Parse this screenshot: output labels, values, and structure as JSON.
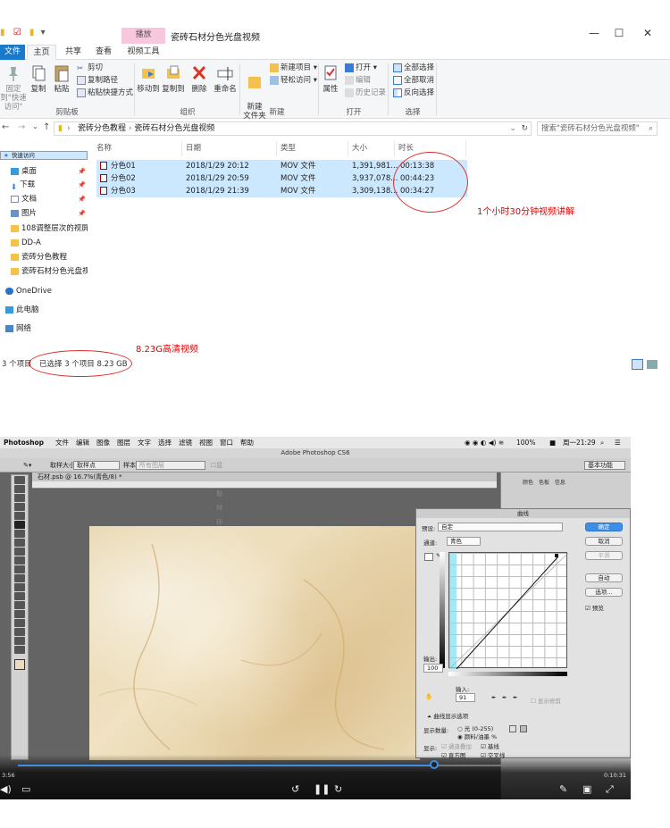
{
  "explorer": {
    "title": "瓷砖石材分色光盘视频",
    "context_tab": "播放",
    "tabs": [
      "文件",
      "主页",
      "共享",
      "查看",
      "视频工具"
    ],
    "ribbon": {
      "clipboard": {
        "pin": "固定到\"快速访问\"",
        "copy": "复制",
        "paste": "粘贴",
        "cut": "剪切",
        "copy_path": "复制路径",
        "paste_shortcut": "粘贴快捷方式",
        "label": "剪贴板"
      },
      "organize": {
        "move_to": "移动到",
        "copy_to": "复制到",
        "delete": "删除",
        "rename": "重命名",
        "label": "组织"
      },
      "new": {
        "new_folder": "新建\n文件夹",
        "new_item": "新建项目",
        "easy_access": "轻松访问",
        "label": "新建"
      },
      "open": {
        "properties": "属性",
        "open": "打开",
        "edit": "编辑",
        "history": "历史记录",
        "label": "打开"
      },
      "select": {
        "select_all": "全部选择",
        "select_none": "全部取消",
        "invert": "反向选择",
        "label": "选择"
      }
    },
    "address": {
      "crumb1": "瓷砖分色教程",
      "crumb2": "瓷砖石材分色光盘视频",
      "search_placeholder": "搜索\"瓷砖石材分色光盘视频\""
    },
    "nav": {
      "quick_access": "快速访问",
      "items": [
        "桌面",
        "下载",
        "文档",
        "图片",
        "108调整层次的视屏",
        "DD-A",
        "瓷砖分色教程",
        "瓷砖石材分色光盘视"
      ],
      "onedrive": "OneDrive",
      "this_pc": "此电脑",
      "network": "网络"
    },
    "columns": [
      "名称",
      "日期",
      "类型",
      "大小",
      "时长"
    ],
    "files": [
      {
        "name": "分色01",
        "date": "2018/1/29 20:12",
        "type": "MOV 文件",
        "size": "1,391,981...",
        "duration": "00:13:38"
      },
      {
        "name": "分色02",
        "date": "2018/1/29 20:59",
        "type": "MOV 文件",
        "size": "3,937,078...",
        "duration": "00:44:23"
      },
      {
        "name": "分色03",
        "date": "2018/1/29 21:39",
        "type": "MOV 文件",
        "size": "3,309,138...",
        "duration": "00:34:27"
      }
    ],
    "status": {
      "count": "3 个项目",
      "selected": "已选择 3 个项目  8.23 GB"
    },
    "annotations": {
      "duration_note": "1个小时30分钟视频讲解",
      "size_note": "8.23G高清视频"
    }
  },
  "video": {
    "mac_menu": [
      "Photoshop",
      "文件",
      "编辑",
      "图像",
      "图层",
      "文字",
      "选择",
      "滤镜",
      "视图",
      "窗口",
      "帮助"
    ],
    "mac_status": "100%",
    "clock": "周一21:29",
    "app_title": "Adobe Photoshop CS6",
    "options": {
      "sample_size_label": "取样大小:",
      "sample_size": "取样点",
      "sample_label": "样本:",
      "sample": "所有图层",
      "show_ring": "显示取样环",
      "workspace": "基本功能"
    },
    "doc_tab": "石材.psb @ 16.7%(青色/8) *",
    "curves": {
      "title": "曲线",
      "preset_label": "预设:",
      "preset": "自定",
      "channel_label": "通道:",
      "channel": "青色",
      "ok": "确定",
      "cancel": "取消",
      "smooth": "平滑",
      "auto": "自动",
      "options": "选项...",
      "preview": "预览",
      "output_label": "输出:",
      "output": "100",
      "input_label": "输入:",
      "input": "91",
      "show_clipping": "显示修剪",
      "display_options": "曲线显示选项",
      "display_amount": "显示数量:",
      "light": "光 (0-255)",
      "pigment": "颜料/油墨 %",
      "show": "显示:",
      "channel_overlays": "通道叠加",
      "baseline": "基线",
      "histogram": "直方图",
      "intersection": "交叉线"
    },
    "panel_tabs": [
      "颜色",
      "色板",
      "信息"
    ],
    "time_current": "3:56",
    "time_total": "0:10:31",
    "progress": 0.7
  }
}
